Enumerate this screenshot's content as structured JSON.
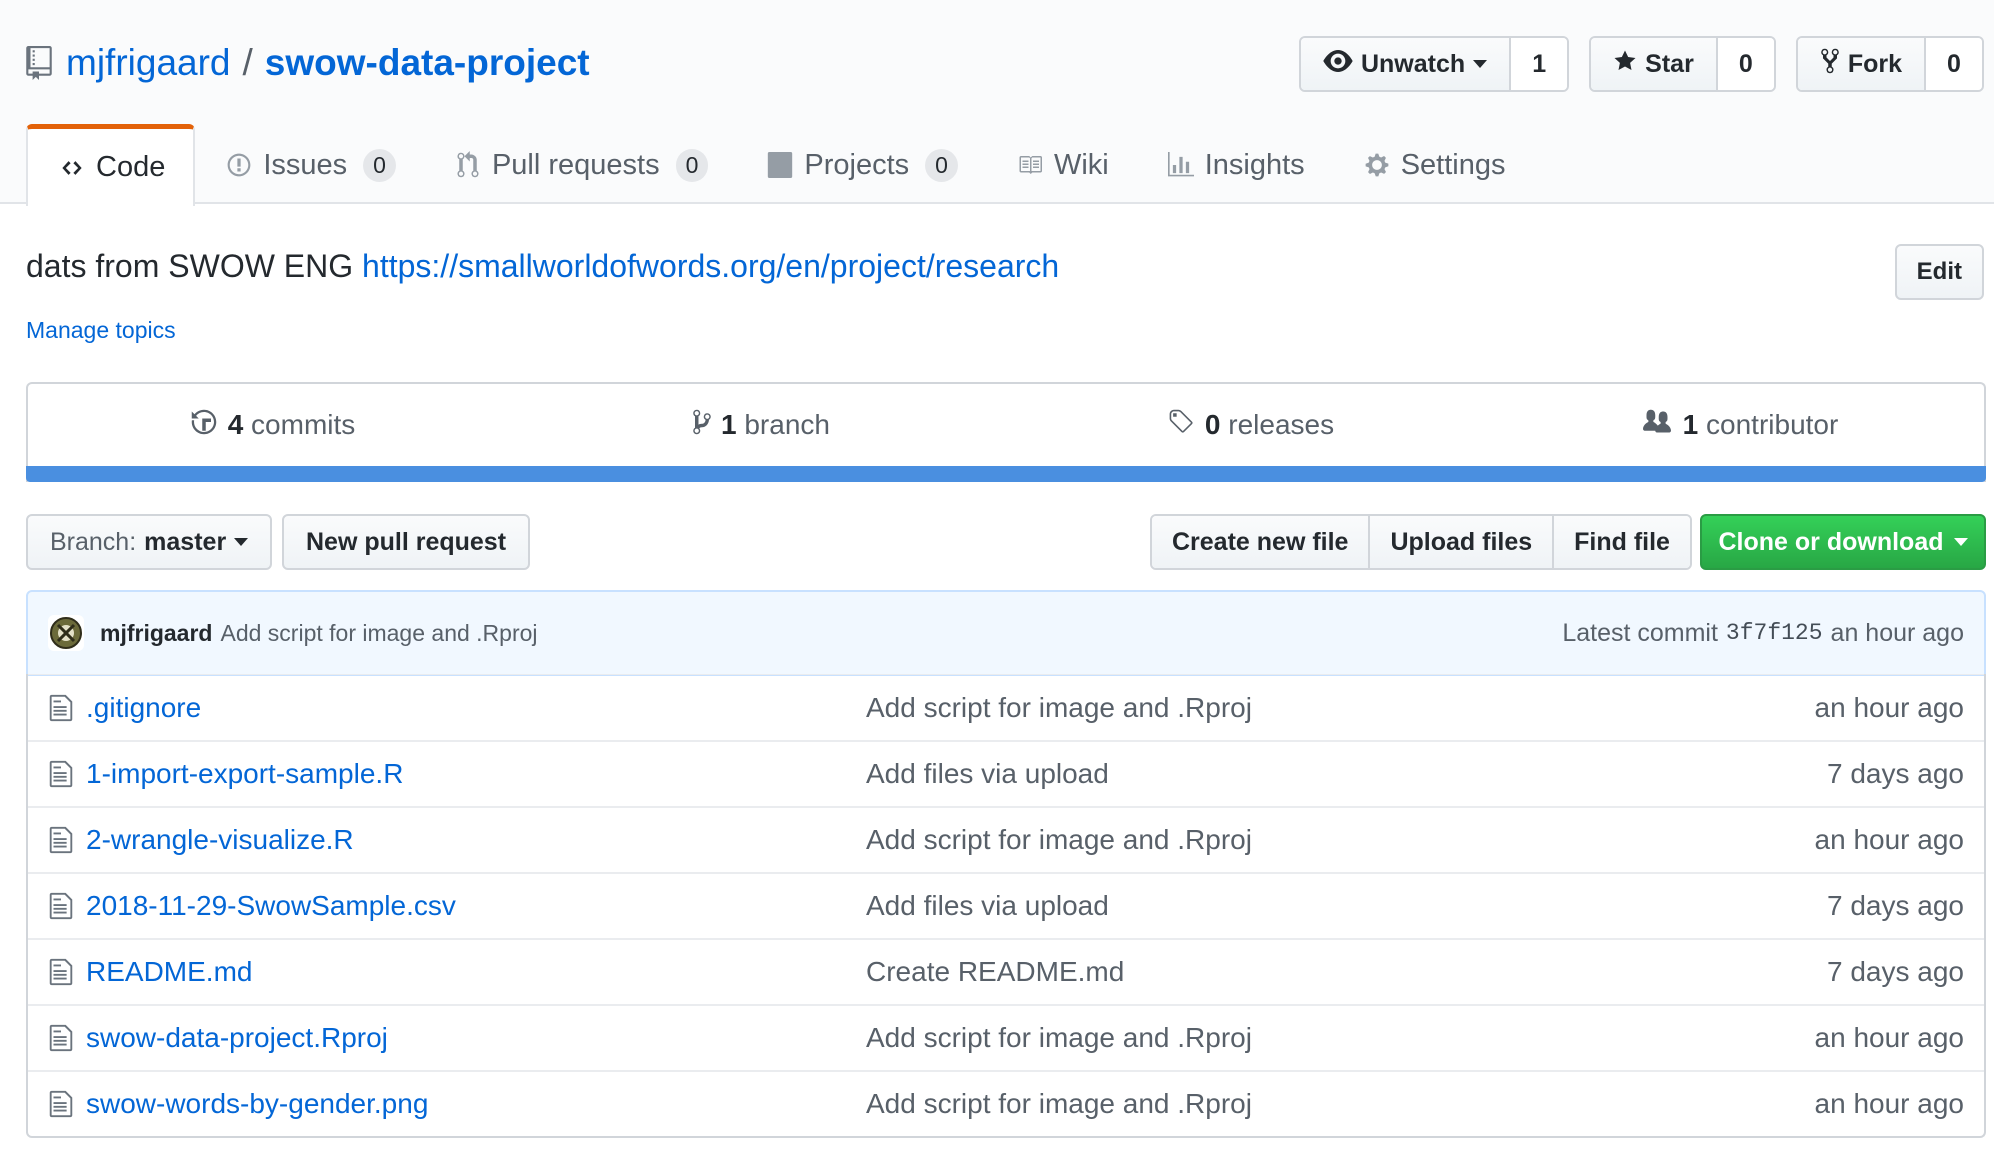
{
  "repo": {
    "owner": "mjfrigaard",
    "separator": "/",
    "name": "swow-data-project"
  },
  "actions": {
    "watch_label": "Unwatch",
    "watch_count": "1",
    "star_label": "Star",
    "star_count": "0",
    "fork_label": "Fork",
    "fork_count": "0"
  },
  "tabs": [
    {
      "label": "Code",
      "icon": "code-icon"
    },
    {
      "label": "Issues",
      "icon": "issue-icon",
      "count": "0"
    },
    {
      "label": "Pull requests",
      "icon": "git-pull-request-icon",
      "count": "0"
    },
    {
      "label": "Projects",
      "icon": "project-icon",
      "count": "0"
    },
    {
      "label": "Wiki",
      "icon": "book-icon"
    },
    {
      "label": "Insights",
      "icon": "graph-icon"
    },
    {
      "label": "Settings",
      "icon": "gear-icon"
    }
  ],
  "description": {
    "text": "dats from SWOW ENG ",
    "link": "https://smallworldofwords.org/en/project/research",
    "edit_label": "Edit",
    "manage_topics": "Manage topics"
  },
  "summary": {
    "commits_num": "4",
    "commits_label": " commits",
    "branch_num": "1",
    "branch_label": " branch",
    "releases_num": "0",
    "releases_label": " releases",
    "contributors_num": "1",
    "contributors_label": " contributor"
  },
  "language_bar_color": "#4a8fe0",
  "file_nav": {
    "branch_prefix": "Branch: ",
    "branch_name": "master",
    "new_pr": "New pull request",
    "create_file": "Create new file",
    "upload_files": "Upload files",
    "find_file": "Find file",
    "clone": "Clone or download"
  },
  "commit": {
    "author": "mjfrigaard",
    "message": "Add script for image and .Rproj",
    "latest_label": "Latest commit",
    "sha": "3f7f125",
    "age": "an hour ago"
  },
  "files": [
    {
      "name": ".gitignore",
      "message": "Add script for image and .Rproj",
      "age": "an hour ago"
    },
    {
      "name": "1-import-export-sample.R",
      "message": "Add files via upload",
      "age": "7 days ago"
    },
    {
      "name": "2-wrangle-visualize.R",
      "message": "Add script for image and .Rproj",
      "age": "an hour ago"
    },
    {
      "name": "2018-11-29-SwowSample.csv",
      "message": "Add files via upload",
      "age": "7 days ago"
    },
    {
      "name": "README.md",
      "message": "Create README.md",
      "age": "7 days ago"
    },
    {
      "name": "swow-data-project.Rproj",
      "message": "Add script for image and .Rproj",
      "age": "an hour ago"
    },
    {
      "name": "swow-words-by-gender.png",
      "message": "Add script for image and .Rproj",
      "age": "an hour ago"
    }
  ]
}
